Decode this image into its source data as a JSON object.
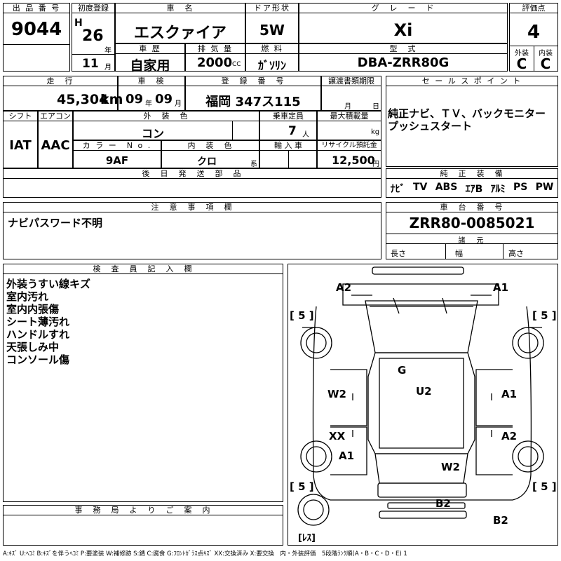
{
  "header_labels": {
    "lot_no": "出 品 番 号",
    "first_reg": "初度登録",
    "car_name": "車　名",
    "door": "ドア形状",
    "grade": "グ　レ　ー　ド",
    "score": "評価点",
    "history": "車 歴",
    "displacement": "排 気 量",
    "fuel": "燃 料",
    "model": "型　式",
    "exterior": "外装",
    "interior": "内装",
    "mileage": "走　行",
    "inspection": "車　検",
    "reg_no": "登　録　番　号",
    "transfer": "譲渡書類期限",
    "sales_point": "セ ー ル ス ポ イ ン ト",
    "shift": "シフト",
    "aircon": "エアコン",
    "ext_color": "外　装　色",
    "capacity": "乗車定員",
    "max_load": "最大積載量",
    "color_no": "カ ラ ー　N o .",
    "int_color": "内　装　色",
    "import": "輸 入 車",
    "recycle": "リサイクル預託金",
    "later_parts": "後　日　発　送　部　品",
    "genuine": "純　正　装　備",
    "notes": "注　意　事　項　欄",
    "chassis": "車　台　番　号",
    "specs": "諸　元",
    "inspector": "検　査　員　記　入　欄",
    "office": "事　務　局　よ　り　ご　案　内"
  },
  "lot_number": "9044",
  "first_registration": {
    "era": "H",
    "year": "26",
    "year_unit": "年",
    "month": "11",
    "month_unit": "月"
  },
  "car_name": "エスクァイア",
  "door": "5W",
  "grade": "Xi",
  "score": "4",
  "history": "自家用",
  "displacement": "2000",
  "displacement_unit": "CC",
  "fuel": "ｶﾞｿﾘﾝ",
  "model_code": "DBA-ZRR80G",
  "exterior_score": "C",
  "interior_score": "C",
  "mileage": "45,304",
  "mileage_unit": "km",
  "inspection": {
    "year": "09",
    "year_unit": "年",
    "month": "09",
    "month_unit": "月"
  },
  "registration_number": "福岡 347ス115",
  "transfer_units": {
    "month": "月",
    "day": "日"
  },
  "sales_points": [
    "純正ナビ、ＴＶ、バックモニター",
    "プッシュスタート"
  ],
  "shift": "IAT",
  "aircon": "AAC",
  "ext_color_value": "コン",
  "capacity": "7",
  "capacity_unit": "人",
  "load_unit": "kg",
  "color_no": "9AF",
  "int_color_value": "クロ",
  "int_color_unit": "系",
  "recycle_fee": "12,500",
  "recycle_unit": "円",
  "genuine_equipment": [
    "ﾅﾋﾞ",
    "TV",
    "ABS",
    "ｴｱB",
    "ｱﾙﾐ",
    "PS",
    "PW"
  ],
  "notes": "ナビパスワード不明",
  "chassis_number": "ZRR80-0085021",
  "spec_labels": {
    "length": "長さ",
    "width": "幅",
    "height": "高さ"
  },
  "inspector_notes": [
    "外装うすい線キズ",
    "室内汚れ",
    "室内内張傷",
    "シート薄汚れ",
    "ハンドルすれ",
    "天張しみ中",
    "コンソール傷"
  ],
  "diagram": {
    "marks": [
      "A2",
      "A1",
      "G",
      "U2",
      "W2",
      "A1",
      "XX",
      "A2",
      "A1",
      "W2",
      "B2",
      "B2"
    ],
    "tires": [
      "[ 5 ]",
      "[ 5 ]",
      "[ 5 ]",
      "[ 5 ]"
    ],
    "spare": "[ﾚｽ]"
  },
  "legend": "A:ｷｽﾞ U:ﾍｺﾐ B:ｷｽﾞを伴うﾍｺﾐ P:要塗装 W:補修跡 S:錆 C:腐食 G:ﾌﾛﾝﾄｶﾞﾗｽ点ｷｽﾞ XX:交換済み X:要交換　内・外装評価　5段階ﾗﾝｸ順(A・B・C・D・E) 1"
}
